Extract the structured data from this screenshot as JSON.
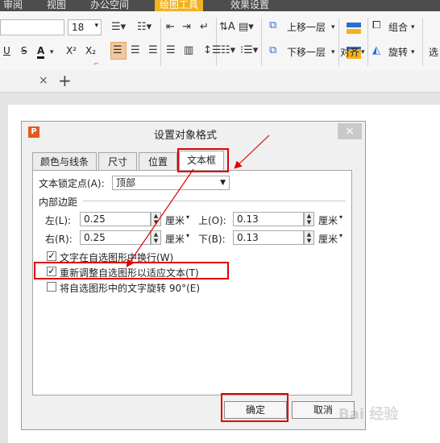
{
  "menu": {
    "tabs": [
      {
        "label": "审阅",
        "active": false
      },
      {
        "label": "视图",
        "active": false
      },
      {
        "label": "办公空间",
        "active": false
      },
      {
        "label": "绘图工具",
        "active": true
      },
      {
        "label": "效果设置",
        "active": false
      }
    ]
  },
  "toolbar": {
    "font_size": "18",
    "bring_forward": "上移一层",
    "send_backward": "下移一层",
    "group": "组合",
    "align": "对齐",
    "rotate": "旋转",
    "select": "选",
    "underline": "U",
    "strike": "S",
    "font_color": "A",
    "superscript": "X²",
    "subscript": "X₂"
  },
  "dialog": {
    "title": "设置对象格式",
    "close": "×",
    "tabs": [
      {
        "label": "颜色与线条",
        "active": false
      },
      {
        "label": "尺寸",
        "active": false
      },
      {
        "label": "位置",
        "active": false
      },
      {
        "label": "文本框",
        "active": true
      }
    ],
    "anchor": {
      "label": "文本锁定点(A):",
      "value": "顶部"
    },
    "margins_heading": "内部边距",
    "margins": {
      "left": {
        "label": "左(L):",
        "value": "0.25",
        "unit": "厘米"
      },
      "top": {
        "label": "上(O):",
        "value": "0.13",
        "unit": "厘米"
      },
      "right": {
        "label": "右(R):",
        "value": "0.25",
        "unit": "厘米"
      },
      "bottom": {
        "label": "下(B):",
        "value": "0.13",
        "unit": "厘米"
      }
    },
    "options": [
      {
        "label": "文字在自选图形中换行(W)",
        "checked": true
      },
      {
        "label": "重新调整自选图形以适应文本(T)",
        "checked": true
      },
      {
        "label": "将自选图形中的文字旋转 90°(E)",
        "checked": false
      }
    ],
    "ok": "确定",
    "cancel": "取消"
  },
  "annotation_color": "#e00000",
  "accent_color": "#f2b11e"
}
